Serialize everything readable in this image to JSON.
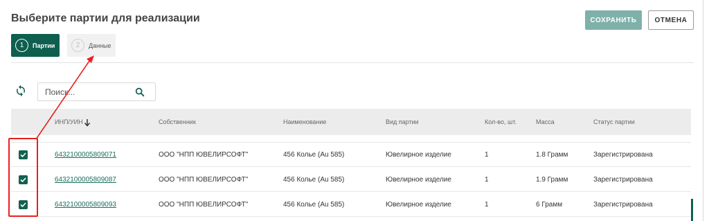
{
  "header": {
    "title": "Выберите партии для реализации",
    "save_label": "СОХРАНИТЬ",
    "cancel_label": "ОТМЕНА"
  },
  "steps": [
    {
      "number": "1",
      "label": "Партии",
      "active": true
    },
    {
      "number": "2",
      "label": "Данные",
      "active": false
    }
  ],
  "search": {
    "placeholder": "Поиск...",
    "value": ""
  },
  "icons": {
    "refresh": "refresh-icon",
    "search": "search-icon",
    "sort": "arrow-down-icon",
    "checkbox": "checkmark-icon"
  },
  "colors": {
    "brand": "#0f5f4f",
    "save_disabled": "#7fb1a9",
    "link": "#1b6f5b",
    "annotation": "#e8201e",
    "header_bg": "#ececec"
  },
  "table": {
    "columns": [
      "ИНП/УИН",
      "Собственник",
      "Наименование",
      "Вид партии",
      "Кол-во, шт.",
      "Масса",
      "Статус партии"
    ],
    "rows": [
      {
        "checked": true,
        "id": "6432100005809071",
        "owner": "ООО \"НПП ЮВЕЛИРСОФТ\"",
        "name": "456 Колье (Au 585)",
        "type": "Ювелирное изделие",
        "qty": "1",
        "mass": "1.8 Грамм",
        "status": "Зарегистрирована"
      },
      {
        "checked": true,
        "id": "6432100005809087",
        "owner": "ООО \"НПП ЮВЕЛИРСОФТ\"",
        "name": "456 Колье (Au 585)",
        "type": "Ювелирное изделие",
        "qty": "1",
        "mass": "1.9 Грамм",
        "status": "Зарегистрирована"
      },
      {
        "checked": true,
        "id": "6432100005809093",
        "owner": "ООО \"НПП ЮВЕЛИРСОФТ\"",
        "name": "456 Колье (Au 585)",
        "type": "Ювелирное изделие",
        "qty": "1",
        "mass": "6 Грамм",
        "status": "Зарегистрирована"
      }
    ]
  }
}
